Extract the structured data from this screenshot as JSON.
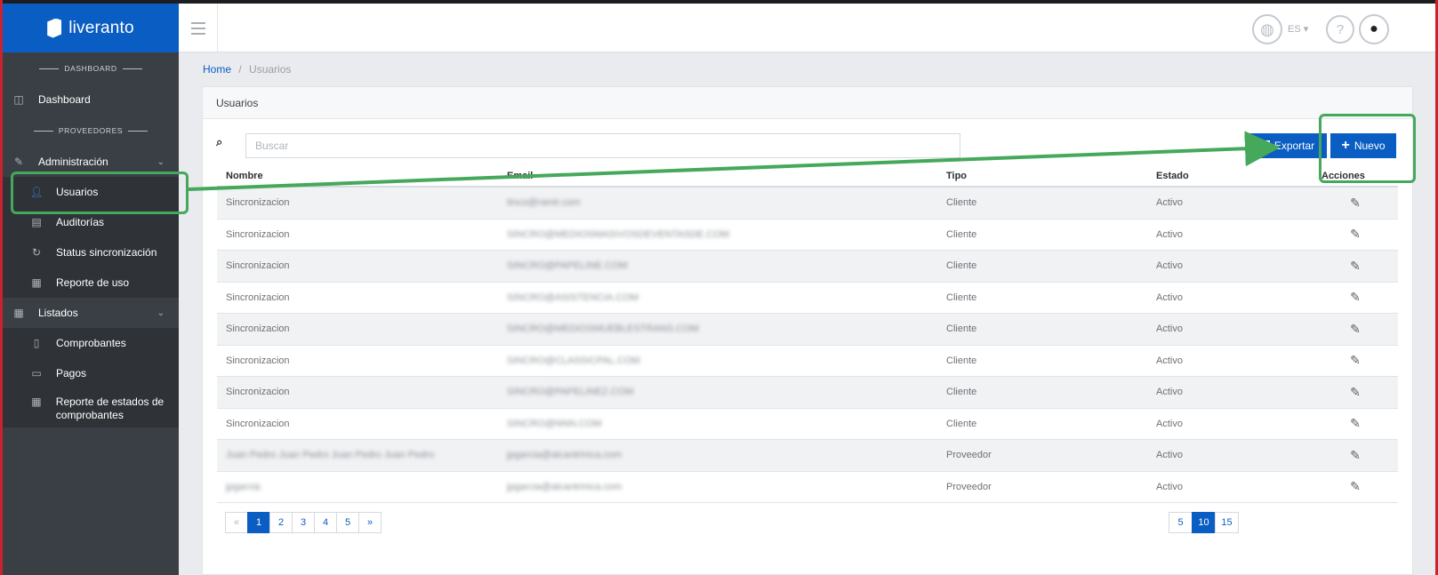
{
  "brand": {
    "name": "liveranto"
  },
  "sidebar": {
    "sections": {
      "dashboard": "DASHBOARD",
      "proveedores": "PROVEEDORES"
    },
    "items": [
      {
        "label": "Dashboard"
      },
      {
        "label": "Administración"
      },
      {
        "label": "Usuarios"
      },
      {
        "label": "Auditorías"
      },
      {
        "label": "Status sincronización"
      },
      {
        "label": "Reporte de uso"
      },
      {
        "label": "Listados"
      },
      {
        "label": "Comprobantes"
      },
      {
        "label": "Pagos"
      },
      {
        "label": "Reporte de estados de comprobantes"
      }
    ]
  },
  "header": {
    "lang": "ES",
    "help_glyph": "?"
  },
  "breadcrumb": {
    "home": "Home",
    "sep": "/",
    "current": "Usuarios"
  },
  "card": {
    "title": "Usuarios"
  },
  "search": {
    "placeholder": "Buscar"
  },
  "buttons": {
    "export": "Exportar",
    "new": "Nuevo",
    "plus": "+"
  },
  "table": {
    "headers": [
      "Nombre",
      "Email",
      "Tipo",
      "Estado",
      "Acciones"
    ],
    "rows": [
      {
        "nombre": "Sincronizacion",
        "email": "tinco@ramir.com",
        "tipo": "Cliente",
        "estado": "Activo"
      },
      {
        "nombre": "Sincronizacion",
        "email": "SINCRO@MEDIOSMASIVOSDEVENTASDE.COM",
        "tipo": "Cliente",
        "estado": "Activo"
      },
      {
        "nombre": "Sincronizacion",
        "email": "SINCRO@PAPELINE.COM",
        "tipo": "Cliente",
        "estado": "Activo"
      },
      {
        "nombre": "Sincronizacion",
        "email": "SINCRO@ASISTENCIA.COM",
        "tipo": "Cliente",
        "estado": "Activo"
      },
      {
        "nombre": "Sincronizacion",
        "email": "SINCRO@MEDIOSMUEBLESTRANS.COM",
        "tipo": "Cliente",
        "estado": "Activo"
      },
      {
        "nombre": "Sincronizacion",
        "email": "SINCRO@CLASSICPAL.COM",
        "tipo": "Cliente",
        "estado": "Activo"
      },
      {
        "nombre": "Sincronizacion",
        "email": "SINCRO@PAPELINEZ.COM",
        "tipo": "Cliente",
        "estado": "Activo"
      },
      {
        "nombre": "Sincronizacion",
        "email": "SINCRO@NNN.COM",
        "tipo": "Cliente",
        "estado": "Activo"
      },
      {
        "nombre": "Juan Pedro Juan Pedro Juan Pedro Juan Pedro",
        "email": "jpgarcia@alcantrinica.com",
        "tipo": "Proveedor",
        "estado": "Activo"
      },
      {
        "nombre": "jpgarcia",
        "email": "jpgarcia@alcantrinica.com",
        "tipo": "Proveedor",
        "estado": "Activo"
      }
    ]
  },
  "pagination": {
    "prev": "«",
    "pages": [
      "1",
      "2",
      "3",
      "4",
      "5"
    ],
    "current": "1",
    "next": "»",
    "page_sizes": [
      "5",
      "10",
      "15"
    ],
    "current_size": "10"
  },
  "colors": {
    "brand_blue": "#0a5dc2",
    "sidebar": "#3a3f45",
    "highlight_green": "#45a85a"
  }
}
